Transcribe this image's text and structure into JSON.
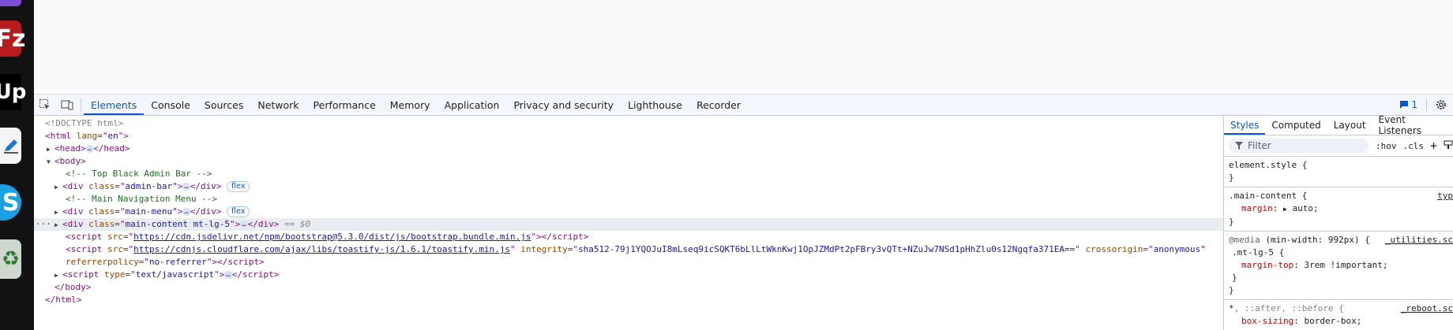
{
  "devtools": {
    "tabs": [
      "Elements",
      "Console",
      "Sources",
      "Network",
      "Performance",
      "Memory",
      "Application",
      "Privacy and security",
      "Lighthouse",
      "Recorder"
    ],
    "active_tab": "Elements",
    "issues_count": "1"
  },
  "dom": {
    "doctype": "<!DOCTYPE html>",
    "html_open_tag": "html",
    "html_lang_attr": "lang",
    "html_lang_val": "en",
    "head_tag": "head",
    "body_tag": "body",
    "comment_admin": "<!-- Top Black Admin Bar -->",
    "div_tag": "div",
    "class_attr": "class",
    "admin_class": "admin-bar",
    "flex_badge": "flex",
    "comment_menu": "<!-- Main Navigation Menu -->",
    "menu_class": "main-menu",
    "content_class": "main-content mt-lg-5",
    "dollar": "== $0",
    "script_tag": "script",
    "src_attr": "src",
    "script1_src": "https://cdn.jsdelivr.net/npm/bootstrap@5.3.0/dist/js/bootstrap.bundle.min.js",
    "script2_src": "https://cdnjs.cloudflare.com/ajax/libs/toastify-js/1.6.1/toastify.min.js",
    "integrity_attr": "integrity",
    "integrity_val": "sha512-79j1YQOJuI8mLseq9icSQKT6bLlLtWknKwj1OpJZMdPt2pFBry3vQTt+NZuJw7NSd1pHhZlu0s12Ngqfa371EA==",
    "crossorigin_attr": "crossorigin",
    "crossorigin_val": "anonymous",
    "referrer_attr": "referrerpolicy",
    "referrer_val": "no-referrer",
    "type_attr": "type",
    "type_val": "text/javascript",
    "ellipsis": "…"
  },
  "styles": {
    "tabs": [
      "Styles",
      "Computed",
      "Layout",
      "Event Listeners"
    ],
    "filter_placeholder": "Filter",
    "hov": ":hov",
    "cls": ".cls",
    "element_style": "element.style {",
    "close_brace": "}",
    "rule1_selector": ".main-content {",
    "rule1_source": "typ",
    "rule1_prop": "margin",
    "rule1_value": "auto;",
    "rule2_media_kw": "@media",
    "rule2_media": "(min-width: 992px) {",
    "rule2_source": "_utilities.sc",
    "rule2_selector": ".mt-lg-5 {",
    "rule2_prop": "margin-top",
    "rule2_value": "3rem !important;",
    "rule3_selector_a": "*",
    "rule3_selector_b": ", ::after, ::before {",
    "rule3_source": "_reboot.sc",
    "rule3_prop": "box-sizing",
    "rule3_value": "border-box;"
  },
  "dock": {
    "filezilla_glyph": "Fz",
    "upwork_glyph": "Up",
    "skype_glyph": "S",
    "trash_glyph": "♻"
  },
  "colors": {
    "accent": "#0b57d0",
    "tag": "#881280",
    "attr": "#994500",
    "value": "#1a1aa6",
    "comment": "#236e25"
  }
}
